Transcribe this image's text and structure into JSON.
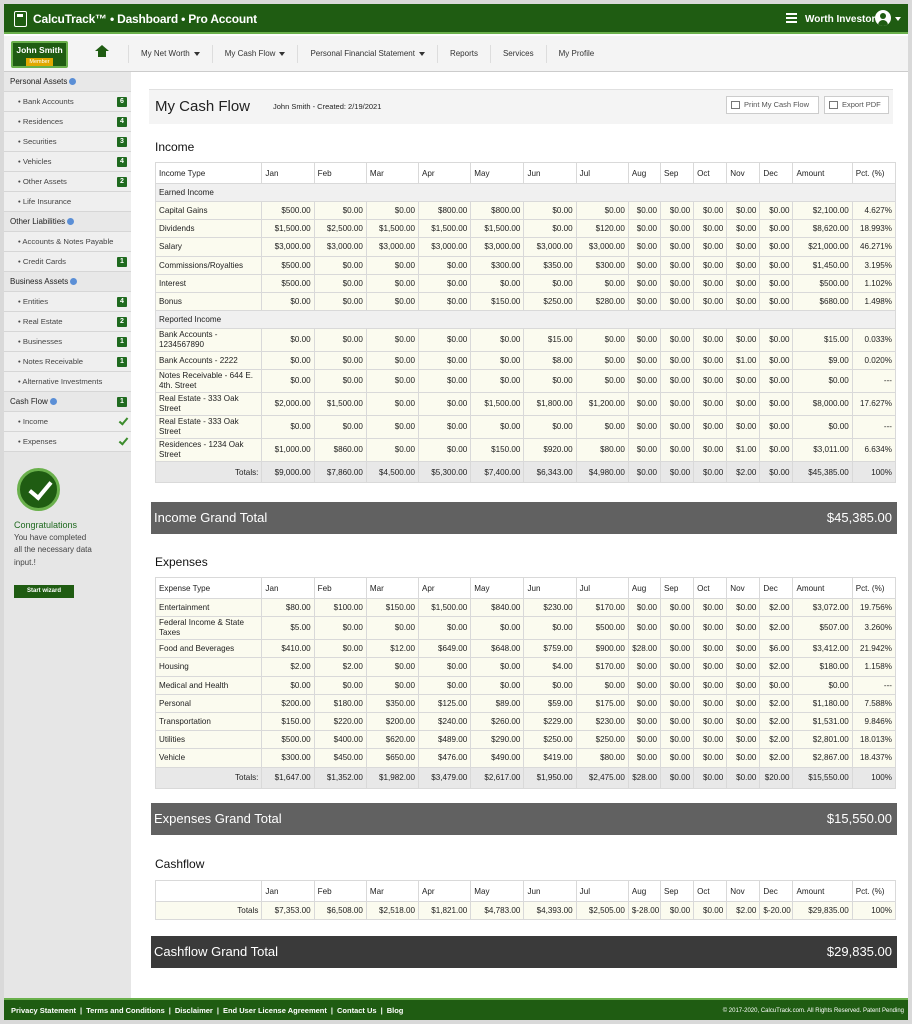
{
  "app": {
    "title": "CalcuTrack™ • Dashboard • Pro Account",
    "user": "Worth Investor"
  },
  "member": {
    "name": "John Smith",
    "badge": "Member"
  },
  "nav": [
    "My Net Worth",
    "My Cash Flow",
    "Personal Financial Statement",
    "Reports",
    "Services",
    "My Profile"
  ],
  "sidebar": {
    "personal_assets": "Personal Assets",
    "pa_items": [
      {
        "label": "• Bank Accounts",
        "badge": "6"
      },
      {
        "label": "• Residences",
        "badge": "4"
      },
      {
        "label": "• Securities",
        "badge": "3"
      },
      {
        "label": "• Vehicles",
        "badge": "4"
      },
      {
        "label": "• Other Assets",
        "badge": "2"
      },
      {
        "label": "• Life Insurance",
        "badge": ""
      }
    ],
    "other_liabilities": "Other Liabilities",
    "ol_items": [
      {
        "label": "• Accounts & Notes Payable",
        "badge": ""
      },
      {
        "label": "• Credit Cards",
        "badge": "1"
      }
    ],
    "business_assets": "Business Assets",
    "ba_items": [
      {
        "label": "• Entities",
        "badge": "4"
      },
      {
        "label": "• Real Estate",
        "badge": "2"
      },
      {
        "label": "• Businesses",
        "badge": "1"
      },
      {
        "label": "• Notes Receivable",
        "badge": "1"
      },
      {
        "label": "• Alternative Investments",
        "badge": ""
      }
    ],
    "cash_flow": "Cash Flow",
    "cash_flow_badge": "1",
    "cf_items": [
      "• Income",
      "• Expenses"
    ],
    "congrats_title": "Congratulations",
    "congrats_text": "You have completed all the necessary data input.!",
    "wizard_button": "Start wizard"
  },
  "page": {
    "title": "My Cash Flow",
    "meta": "John Smith -  Created: 2/19/2021",
    "print_button": "Print My Cash Flow",
    "export_button": "Export PDF"
  },
  "months": [
    "Jan",
    "Feb",
    "Mar",
    "Apr",
    "May",
    "Jun",
    "Jul",
    "Aug",
    "Sep",
    "Oct",
    "Nov",
    "Dec"
  ],
  "amount_header": "Amount",
  "pct_header": "Pct. (%)",
  "income": {
    "title": "Income",
    "type_header": "Income Type",
    "groups": [
      {
        "name": "Earned Income",
        "rows": [
          {
            "label": "Capital Gains",
            "values": [
              "$500.00",
              "$0.00",
              "$0.00",
              "$800.00",
              "$800.00",
              "$0.00",
              "$0.00",
              "$0.00",
              "$0.00",
              "$0.00",
              "$0.00",
              "$0.00"
            ],
            "amount": "$2,100.00",
            "pct": "4.627%"
          },
          {
            "label": "Dividends",
            "values": [
              "$1,500.00",
              "$2,500.00",
              "$1,500.00",
              "$1,500.00",
              "$1,500.00",
              "$0.00",
              "$120.00",
              "$0.00",
              "$0.00",
              "$0.00",
              "$0.00",
              "$0.00"
            ],
            "amount": "$8,620.00",
            "pct": "18.993%"
          },
          {
            "label": "Salary",
            "values": [
              "$3,000.00",
              "$3,000.00",
              "$3,000.00",
              "$3,000.00",
              "$3,000.00",
              "$3,000.00",
              "$3,000.00",
              "$0.00",
              "$0.00",
              "$0.00",
              "$0.00",
              "$0.00"
            ],
            "amount": "$21,000.00",
            "pct": "46.271%"
          },
          {
            "label": "Commissions/Royalties",
            "values": [
              "$500.00",
              "$0.00",
              "$0.00",
              "$0.00",
              "$300.00",
              "$350.00",
              "$300.00",
              "$0.00",
              "$0.00",
              "$0.00",
              "$0.00",
              "$0.00"
            ],
            "amount": "$1,450.00",
            "pct": "3.195%"
          },
          {
            "label": "Interest",
            "values": [
              "$500.00",
              "$0.00",
              "$0.00",
              "$0.00",
              "$0.00",
              "$0.00",
              "$0.00",
              "$0.00",
              "$0.00",
              "$0.00",
              "$0.00",
              "$0.00"
            ],
            "amount": "$500.00",
            "pct": "1.102%"
          },
          {
            "label": "Bonus",
            "values": [
              "$0.00",
              "$0.00",
              "$0.00",
              "$0.00",
              "$150.00",
              "$250.00",
              "$280.00",
              "$0.00",
              "$0.00",
              "$0.00",
              "$0.00",
              "$0.00"
            ],
            "amount": "$680.00",
            "pct": "1.498%"
          }
        ]
      },
      {
        "name": "Reported Income",
        "rows": [
          {
            "label": "Bank Accounts - 1234567890",
            "values": [
              "$0.00",
              "$0.00",
              "$0.00",
              "$0.00",
              "$0.00",
              "$15.00",
              "$0.00",
              "$0.00",
              "$0.00",
              "$0.00",
              "$0.00",
              "$0.00"
            ],
            "amount": "$15.00",
            "pct": "0.033%"
          },
          {
            "label": "Bank Accounts - 2222",
            "values": [
              "$0.00",
              "$0.00",
              "$0.00",
              "$0.00",
              "$0.00",
              "$8.00",
              "$0.00",
              "$0.00",
              "$0.00",
              "$0.00",
              "$1.00",
              "$0.00"
            ],
            "amount": "$9.00",
            "pct": "0.020%"
          },
          {
            "label": "Notes Receivable - 644 E. 4th. Street",
            "values": [
              "$0.00",
              "$0.00",
              "$0.00",
              "$0.00",
              "$0.00",
              "$0.00",
              "$0.00",
              "$0.00",
              "$0.00",
              "$0.00",
              "$0.00",
              "$0.00"
            ],
            "amount": "$0.00",
            "pct": "---"
          },
          {
            "label": "Real Estate - 333 Oak Street",
            "values": [
              "$2,000.00",
              "$1,500.00",
              "$0.00",
              "$0.00",
              "$1,500.00",
              "$1,800.00",
              "$1,200.00",
              "$0.00",
              "$0.00",
              "$0.00",
              "$0.00",
              "$0.00"
            ],
            "amount": "$8,000.00",
            "pct": "17.627%"
          },
          {
            "label": "Real Estate - 333 Oak Street",
            "values": [
              "$0.00",
              "$0.00",
              "$0.00",
              "$0.00",
              "$0.00",
              "$0.00",
              "$0.00",
              "$0.00",
              "$0.00",
              "$0.00",
              "$0.00",
              "$0.00"
            ],
            "amount": "$0.00",
            "pct": "---"
          },
          {
            "label": "Residences - 1234 Oak Street",
            "values": [
              "$1,000.00",
              "$860.00",
              "$0.00",
              "$0.00",
              "$150.00",
              "$920.00",
              "$80.00",
              "$0.00",
              "$0.00",
              "$0.00",
              "$1.00",
              "$0.00"
            ],
            "amount": "$3,011.00",
            "pct": "6.634%"
          }
        ]
      }
    ],
    "totals_label": "Totals:",
    "totals": [
      "$9,000.00",
      "$7,860.00",
      "$4,500.00",
      "$5,300.00",
      "$7,400.00",
      "$6,343.00",
      "$4,980.00",
      "$0.00",
      "$0.00",
      "$0.00",
      "$2.00",
      "$0.00"
    ],
    "totals_amount": "$45,385.00",
    "totals_pct": "100%",
    "grand_label": "Income Grand Total",
    "grand_value": "$45,385.00"
  },
  "expenses": {
    "title": "Expenses",
    "type_header": "Expense Type",
    "rows": [
      {
        "label": "Entertainment",
        "values": [
          "$80.00",
          "$100.00",
          "$150.00",
          "$1,500.00",
          "$840.00",
          "$230.00",
          "$170.00",
          "$0.00",
          "$0.00",
          "$0.00",
          "$0.00",
          "$2.00"
        ],
        "amount": "$3,072.00",
        "pct": "19.756%"
      },
      {
        "label": "Federal Income & State Taxes",
        "values": [
          "$5.00",
          "$0.00",
          "$0.00",
          "$0.00",
          "$0.00",
          "$0.00",
          "$500.00",
          "$0.00",
          "$0.00",
          "$0.00",
          "$0.00",
          "$2.00"
        ],
        "amount": "$507.00",
        "pct": "3.260%"
      },
      {
        "label": "Food and Beverages",
        "values": [
          "$410.00",
          "$0.00",
          "$12.00",
          "$649.00",
          "$648.00",
          "$759.00",
          "$900.00",
          "$28.00",
          "$0.00",
          "$0.00",
          "$0.00",
          "$6.00"
        ],
        "amount": "$3,412.00",
        "pct": "21.942%"
      },
      {
        "label": "Housing",
        "values": [
          "$2.00",
          "$2.00",
          "$0.00",
          "$0.00",
          "$0.00",
          "$4.00",
          "$170.00",
          "$0.00",
          "$0.00",
          "$0.00",
          "$0.00",
          "$2.00"
        ],
        "amount": "$180.00",
        "pct": "1.158%"
      },
      {
        "label": "Medical and Health",
        "values": [
          "$0.00",
          "$0.00",
          "$0.00",
          "$0.00",
          "$0.00",
          "$0.00",
          "$0.00",
          "$0.00",
          "$0.00",
          "$0.00",
          "$0.00",
          "$0.00"
        ],
        "amount": "$0.00",
        "pct": "---"
      },
      {
        "label": "Personal",
        "values": [
          "$200.00",
          "$180.00",
          "$350.00",
          "$125.00",
          "$89.00",
          "$59.00",
          "$175.00",
          "$0.00",
          "$0.00",
          "$0.00",
          "$0.00",
          "$2.00"
        ],
        "amount": "$1,180.00",
        "pct": "7.588%"
      },
      {
        "label": "Transportation",
        "values": [
          "$150.00",
          "$220.00",
          "$200.00",
          "$240.00",
          "$260.00",
          "$229.00",
          "$230.00",
          "$0.00",
          "$0.00",
          "$0.00",
          "$0.00",
          "$2.00"
        ],
        "amount": "$1,531.00",
        "pct": "9.846%"
      },
      {
        "label": "Utilities",
        "values": [
          "$500.00",
          "$400.00",
          "$620.00",
          "$489.00",
          "$290.00",
          "$250.00",
          "$250.00",
          "$0.00",
          "$0.00",
          "$0.00",
          "$0.00",
          "$2.00"
        ],
        "amount": "$2,801.00",
        "pct": "18.013%"
      },
      {
        "label": "Vehicle",
        "values": [
          "$300.00",
          "$450.00",
          "$650.00",
          "$476.00",
          "$490.00",
          "$419.00",
          "$80.00",
          "$0.00",
          "$0.00",
          "$0.00",
          "$0.00",
          "$2.00"
        ],
        "amount": "$2,867.00",
        "pct": "18.437%"
      }
    ],
    "totals_label": "Totals:",
    "totals": [
      "$1,647.00",
      "$1,352.00",
      "$1,982.00",
      "$3,479.00",
      "$2,617.00",
      "$1,950.00",
      "$2,475.00",
      "$28.00",
      "$0.00",
      "$0.00",
      "$0.00",
      "$20.00"
    ],
    "totals_amount": "$15,550.00",
    "totals_pct": "100%",
    "grand_label": "Expenses Grand Total",
    "grand_value": "$15,550.00"
  },
  "cashflow": {
    "title": "Cashflow",
    "pct_header": "Pct. (%)",
    "totals_label": "Totals",
    "totals": [
      "$7,353.00",
      "$6,508.00",
      "$2,518.00",
      "$1,821.00",
      "$4,783.00",
      "$4,393.00",
      "$2,505.00",
      "$-28.00",
      "$0.00",
      "$0.00",
      "$2.00",
      "$-20.00"
    ],
    "totals_amount": "$29,835.00",
    "totals_pct": "100%",
    "grand_label": "Cashflow Grand Total",
    "grand_value": "$29,835.00"
  },
  "footer": {
    "links": [
      "Privacy Statement",
      "Terms and Conditions",
      "Disclaimer",
      "End User License Agreement",
      "Contact Us",
      "Blog"
    ],
    "copyright": "© 2017-2020, CalcuTrack.com. All Rights Reserved. Patent Pending"
  },
  "colors": {
    "brand_green": "#1f5c12",
    "accent_green": "#6ab04c",
    "grand_total_bg": "#616161",
    "cashflow_grand_bg": "#3a3a3a"
  }
}
